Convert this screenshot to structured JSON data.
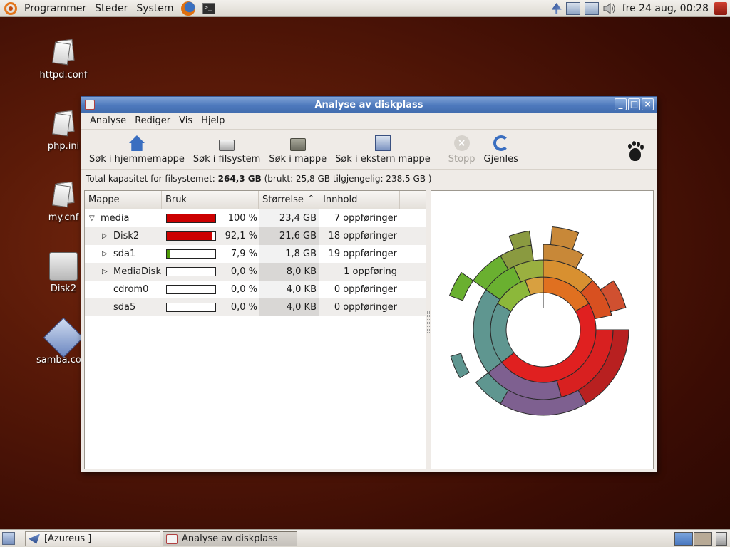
{
  "top_panel": {
    "menus": [
      "Programmer",
      "Steder",
      "System"
    ],
    "clock": "fre 24 aug, 00:28"
  },
  "desktop_icons": [
    "httpd.conf",
    "php.ini",
    "my.cnf",
    "Disk2",
    "samba.conf"
  ],
  "window": {
    "title": "Analyse av diskplass",
    "menubar": [
      "Analyse",
      "Rediger",
      "Vis",
      "Hjelp"
    ],
    "toolbar": {
      "home": "Søk i hjemmemappe",
      "filesystem": "Søk i filsystem",
      "folder": "Søk i mappe",
      "remote": "Søk i ekstern mappe",
      "stop": "Stopp",
      "reload": "Gjenles"
    },
    "capacity": {
      "prefix": "Total kapasitet for filsystemet:",
      "total": "264,3 GB",
      "detail": "(brukt: 25,8 GB tilgjengelig: 238,5 GB )"
    },
    "columns": {
      "folder": "Mappe",
      "usage": "Bruk",
      "size": "Størrelse",
      "contents": "Innhold"
    },
    "rows": [
      {
        "name": "media",
        "pct_text": "100 %",
        "fraction": 1.0,
        "color": "#cc0000",
        "size": "23,4 GB",
        "contents": "7 oppføringer"
      },
      {
        "name": "Disk2",
        "pct_text": "92,1 %",
        "fraction": 0.921,
        "color": "#cc0000",
        "size": "21,6 GB",
        "contents": "18 oppføringer"
      },
      {
        "name": "sda1",
        "pct_text": "7,9 %",
        "fraction": 0.079,
        "color": "#4e9a06",
        "size": "1,8 GB",
        "contents": "19 oppføringer"
      },
      {
        "name": "MediaDisk",
        "pct_text": "0,0 %",
        "fraction": 0.0,
        "color": "#cc0000",
        "size": "8,0 KB",
        "contents": "1 oppføring"
      },
      {
        "name": "cdrom0",
        "pct_text": "0,0 %",
        "fraction": 0.0,
        "color": "#cc0000",
        "size": "4,0 KB",
        "contents": "0 oppføringer"
      },
      {
        "name": "sda5",
        "pct_text": "0,0 %",
        "fraction": 0.0,
        "color": "#cc0000",
        "size": "4,0 KB",
        "contents": "0 oppføringer"
      }
    ]
  },
  "taskbar": {
    "tasks": [
      "[Azureus ]",
      "Analyse av diskplass"
    ]
  }
}
